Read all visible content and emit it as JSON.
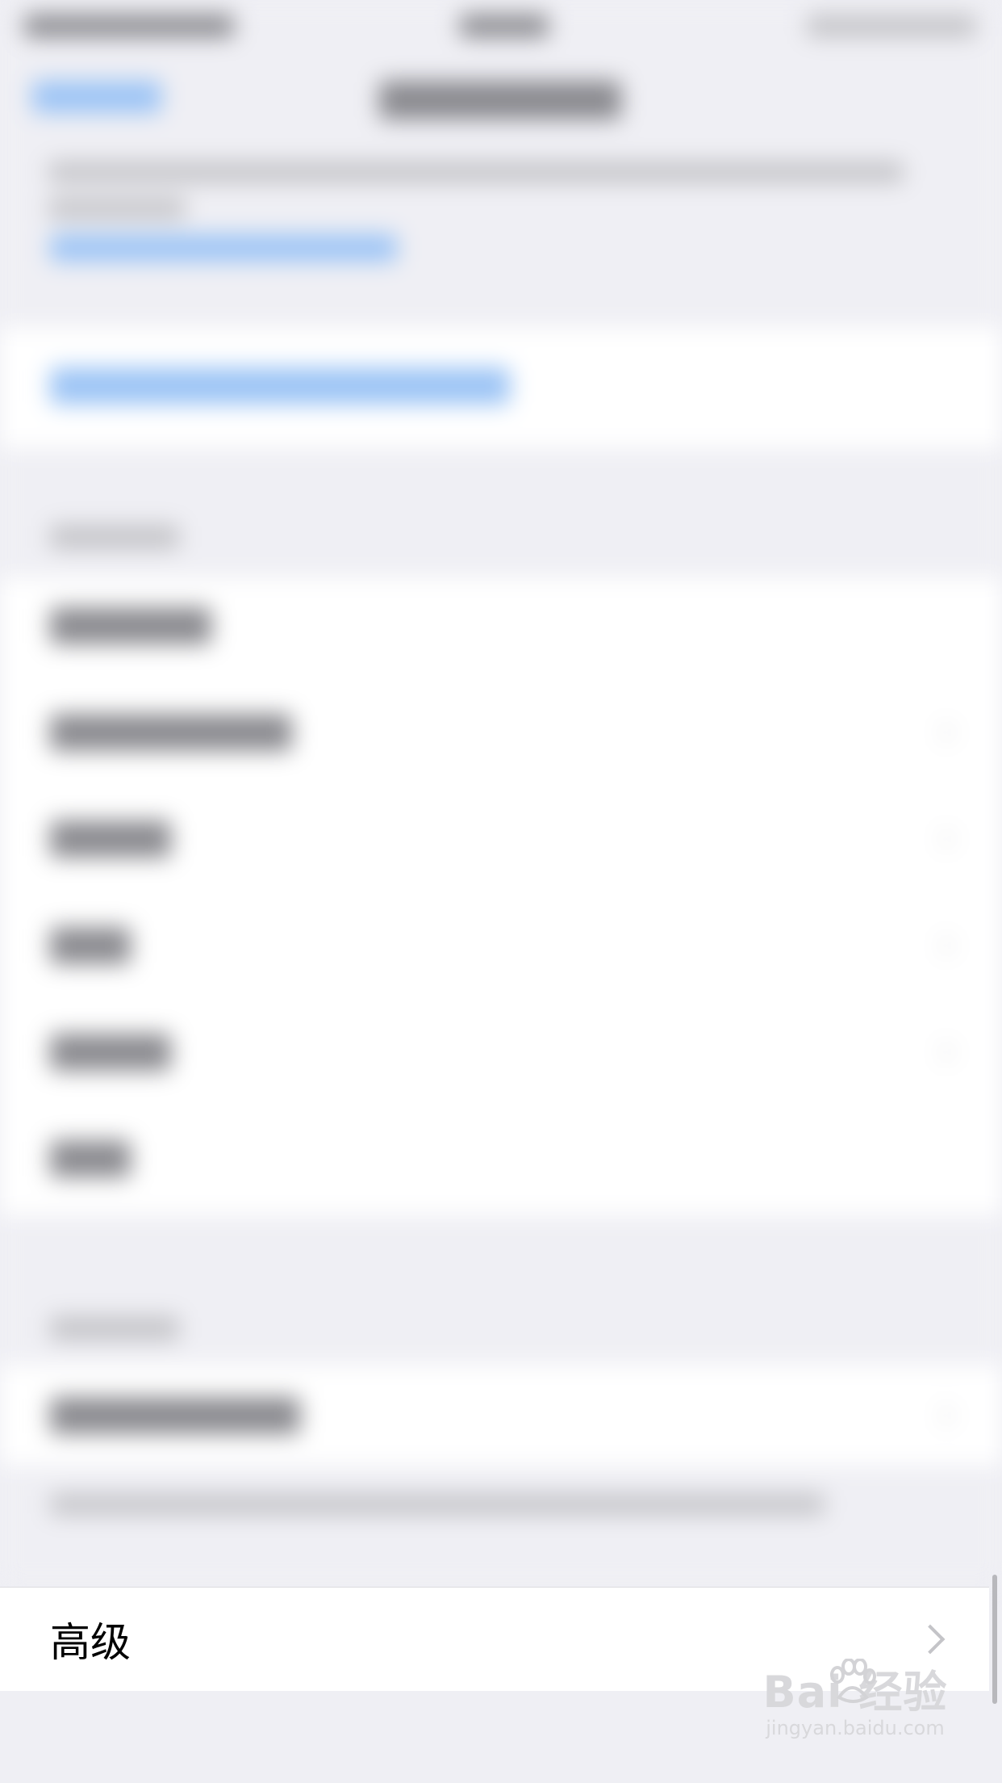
{
  "settings": {
    "advanced_label": "高级"
  },
  "watermark": {
    "brand": "Bai  经验",
    "url": "jingyan.baidu.com"
  },
  "icons": {
    "row_chevron": "chevron-right-icon"
  }
}
